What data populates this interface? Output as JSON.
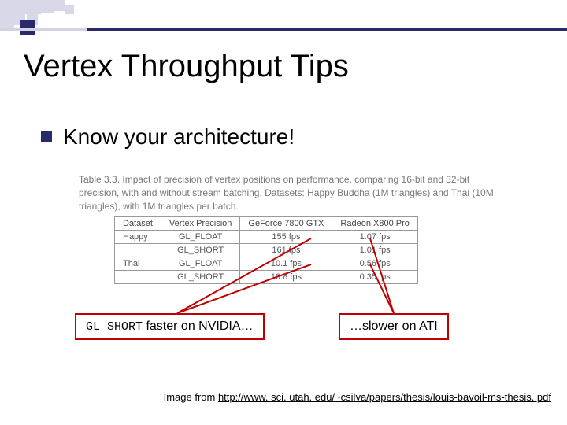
{
  "title": "Vertex Throughput Tips",
  "bullet": "Know your architecture!",
  "table_caption": "Table 3.3. Impact of precision of vertex positions on performance, comparing 16-bit and 32-bit precision, with and without stream batching. Datasets: Happy Buddha (1M triangles) and Thai (10M triangles), with 1M triangles per batch.",
  "table": {
    "headers": [
      "Dataset",
      "Vertex Precision",
      "GeForce 7800 GTX",
      "Radeon X800 Pro"
    ],
    "rows": [
      [
        "Happy",
        "GL_FLOAT",
        "155 fps",
        "1.07 fps"
      ],
      [
        "",
        "GL_SHORT",
        "161 fps",
        "1.01 fps"
      ],
      [
        "Thai",
        "GL_FLOAT",
        "10.1 fps",
        "0.56 fps"
      ],
      [
        "",
        "GL_SHORT",
        "10.8 fps",
        "0.35 fps"
      ]
    ]
  },
  "callout_left_code": "GL_SHORT",
  "callout_left_rest": " faster on NVIDIA…",
  "callout_right": "…slower on ATI",
  "cite_prefix": "Image from ",
  "cite_link": "http://www. sci. utah. edu/~csilva/papers/thesis/louis-bavoil-ms-thesis. pdf"
}
